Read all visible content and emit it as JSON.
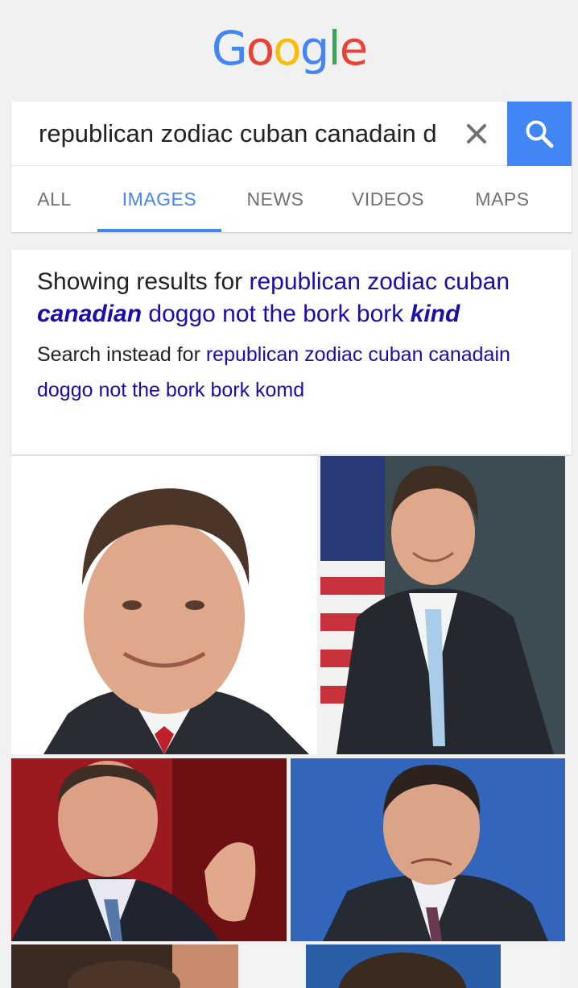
{
  "logo": {
    "letters": [
      "G",
      "o",
      "o",
      "g",
      "l",
      "e"
    ],
    "colors": [
      "#4285f4",
      "#ea4335",
      "#fbbc05",
      "#4285f4",
      "#34a853",
      "#ea4335"
    ]
  },
  "search": {
    "query": "republican zodiac cuban canadain d",
    "placeholder": ""
  },
  "tabs": [
    "ALL",
    "IMAGES",
    "NEWS",
    "VIDEOS",
    "MAPS"
  ],
  "active_tab": "IMAGES",
  "spelling": {
    "showing_prefix": "Showing results for",
    "corrected_part1": "republican zodiac cuban",
    "corrected_bold1": "canadian",
    "corrected_part2": "doggo not the bork bork",
    "corrected_bold2": "kind",
    "instead_prefix": "Search instead for",
    "original_query": "republican zodiac cuban canadain doggo not the bork bork komd"
  },
  "colors": {
    "accent": "#4285f4",
    "link": "#1a0dab",
    "background": "#f1f1f1"
  }
}
